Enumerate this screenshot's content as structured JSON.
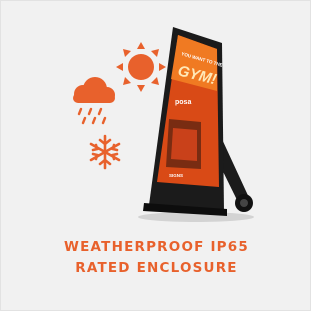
{
  "caption": {
    "line1": "WEATHERPROOF IP65",
    "line2": "RATED ENCLOSURE"
  },
  "screen": {
    "headline_top": "YOU WANT TO THE",
    "headline_main": "GYM!",
    "brand_small": "posa",
    "footer_text": "SIGNS"
  },
  "icons": [
    "sun-icon",
    "rain-cloud-icon",
    "snowflake-icon",
    "display-stand"
  ],
  "colors": {
    "accent": "#e8612c",
    "card_background": "#f1f1f1",
    "stand_body": "#1b1b1b"
  }
}
